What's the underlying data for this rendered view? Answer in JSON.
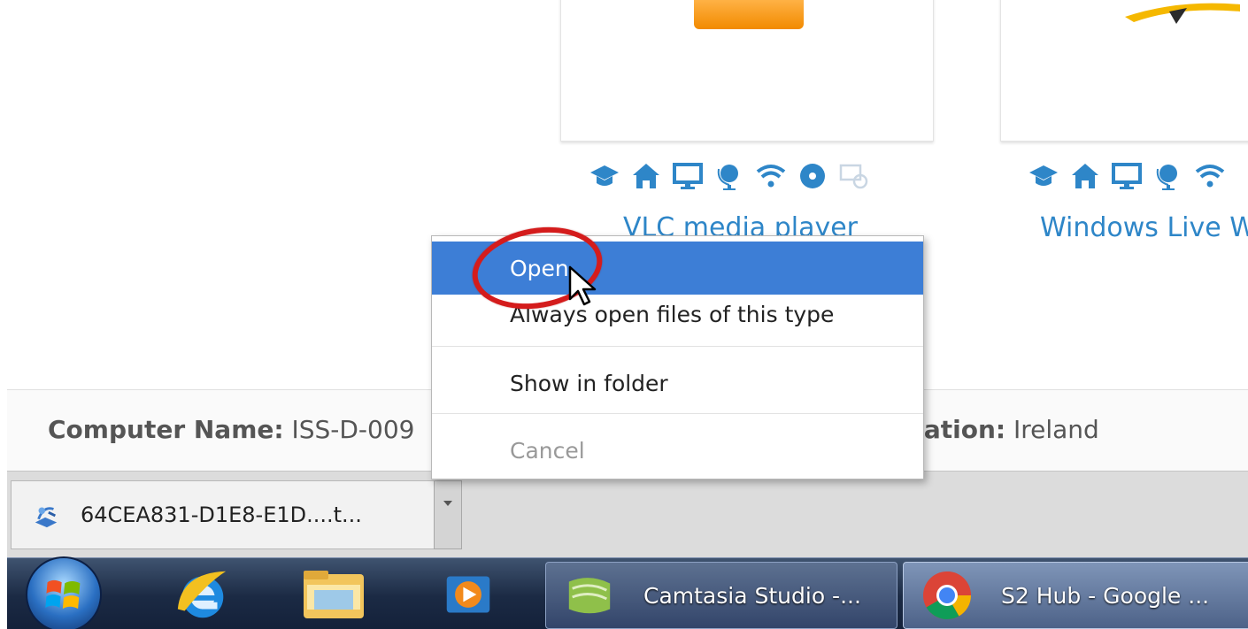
{
  "catalog": {
    "apps": [
      {
        "name": "VLC media player",
        "feature_icons": [
          "graduation-cap-icon",
          "home-icon",
          "monitor-icon",
          "globe-stand-icon",
          "wifi-icon",
          "disc-icon",
          "screens-sync-icon"
        ]
      },
      {
        "name": "Windows Live W",
        "feature_icons": [
          "graduation-cap-icon",
          "home-icon",
          "monitor-icon",
          "globe-stand-icon",
          "wifi-icon"
        ]
      }
    ],
    "accent_color": "#2e86c8"
  },
  "info_bar": {
    "computer_name_label": "Computer Name:",
    "computer_name_value": " ISS-D-009",
    "location_label": "ocation:",
    "location_value": " Ireland"
  },
  "context_menu": {
    "items": [
      {
        "label": "Open",
        "state": "highlighted"
      },
      {
        "label": "Always open files of this type",
        "state": "normal"
      },
      {
        "label": "Show in folder",
        "state": "normal"
      },
      {
        "label": "Cancel",
        "state": "disabled"
      }
    ],
    "highlight_color": "#3d7ed6",
    "annotation_color": "#d41c1c"
  },
  "download_shelf": {
    "file_name": "64CEA831-D1E8-E1D....t...",
    "file_icon": "install-package-icon"
  },
  "taskbar": {
    "pinned": [
      "windows-start-orb-icon",
      "internet-explorer-icon",
      "file-explorer-icon",
      "media-player-icon"
    ],
    "buttons": [
      {
        "label": "Camtasia Studio -...",
        "icon": "camtasia-icon"
      },
      {
        "label": "S2 Hub - Google ...",
        "icon": "chrome-icon"
      }
    ]
  }
}
